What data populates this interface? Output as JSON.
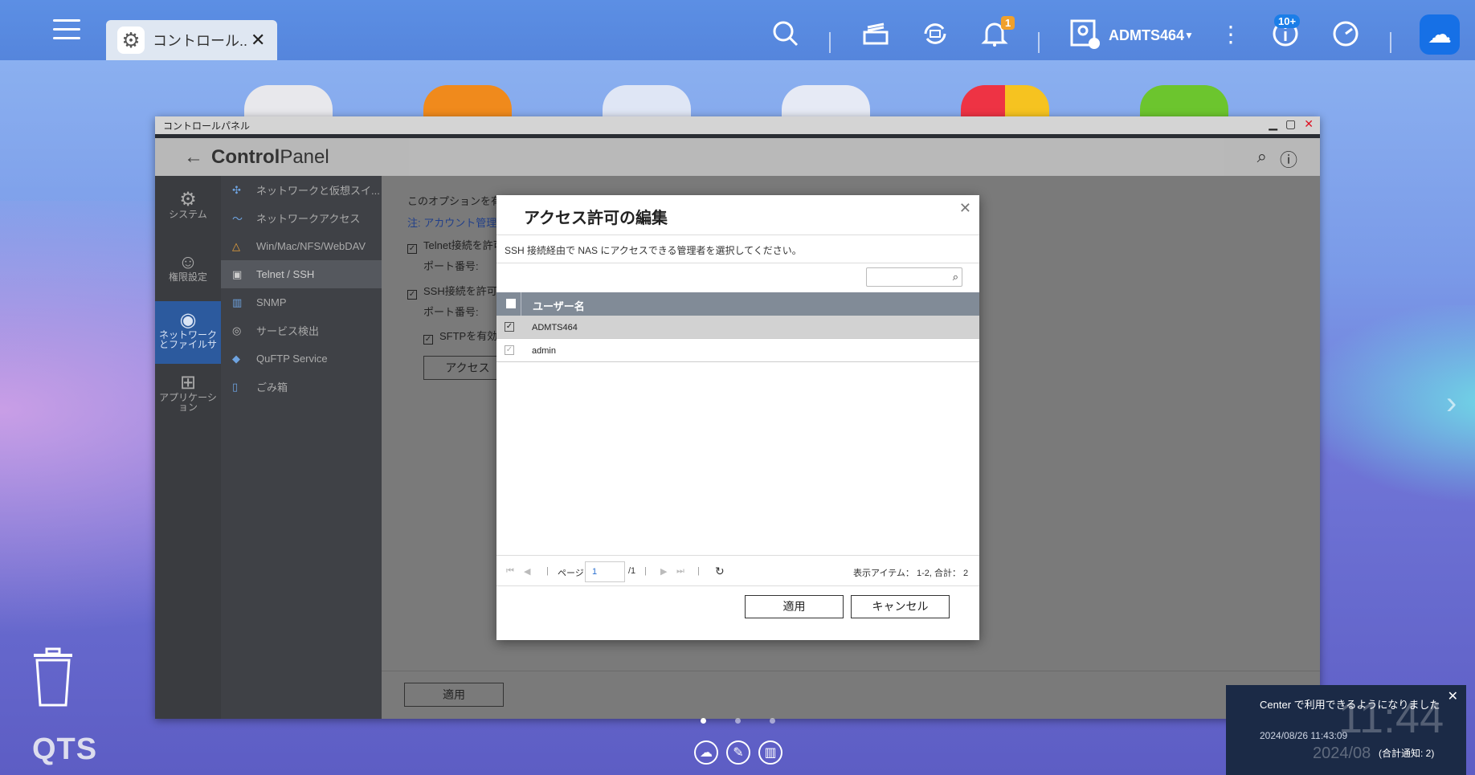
{
  "topbar": {
    "app_tab_label": "コントロール...",
    "notification_badge": "1",
    "user_name": "ADMTS464",
    "update_badge": "10+"
  },
  "window": {
    "title": "コントロールパネル",
    "header_title_bold": "Control",
    "header_title_rest": "Panel"
  },
  "nav_primary": [
    {
      "label": "システム",
      "icon": "gear-icon"
    },
    {
      "label": "権限設定",
      "icon": "user-icon"
    },
    {
      "label": "ネットワークとファイルサ",
      "icon": "globe-icon"
    },
    {
      "label": "アプリケーション",
      "icon": "apps-icon"
    }
  ],
  "nav_secondary": [
    {
      "label": "ネットワークと仮想スイ..."
    },
    {
      "label": "ネットワークアクセス"
    },
    {
      "label": "Win/Mac/NFS/WebDAV"
    },
    {
      "label": "Telnet / SSH"
    },
    {
      "label": "SNMP"
    },
    {
      "label": "サービス検出"
    },
    {
      "label": "QuFTP Service"
    },
    {
      "label": "ごみ箱"
    }
  ],
  "content": {
    "line1": "このオプションを有",
    "note": "注: アカウント管理者",
    "telnet_label": "Telnet接続を許可",
    "port_label1": "ポート番号:",
    "ssh_label": "SSH接続を許可",
    "port_label2": "ポート番号:",
    "sftp_label": "SFTPを有効",
    "access_button": "アクセス",
    "apply_button": "適用"
  },
  "dialog": {
    "title": "アクセス許可の編集",
    "description": "SSH 接続経由で NAS にアクセスできる管理者を選択してください。",
    "column_header": "ユーザー名",
    "rows": [
      {
        "name": "ADMTS464",
        "checked": "✓"
      },
      {
        "name": "admin",
        "checked": "✓"
      }
    ],
    "page_label": "ページ",
    "page_value": "1",
    "page_total": "/1",
    "items_summary": "表示アイテム： 1-2, 合計： 2",
    "apply_button": "適用",
    "cancel_button": "キャンセル"
  },
  "desktop": {
    "brand": "QTS"
  },
  "notification": {
    "message": "Center で利用できるようになりました",
    "timestamp": "2024/08/26 11:43:09",
    "bg_time": "11:44",
    "bg_date": "2024/08",
    "count": "(合計通知: 2)"
  }
}
